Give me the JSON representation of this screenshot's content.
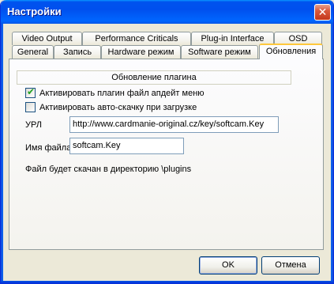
{
  "window": {
    "title": "Настройки"
  },
  "titlebar": {
    "close_glyph": "✕"
  },
  "tabs_row1": [
    "Video Output",
    "Performance Criticals",
    "Plug-in Interface",
    "OSD"
  ],
  "tabs_row2": [
    "General",
    "Запись",
    "Hardware режим",
    "Software режим",
    "Обновления"
  ],
  "panel": {
    "group_title": "Обновление плагина",
    "check_update_label": "Активировать плагин файл апдейт меню",
    "check_update_checked": true,
    "check_autodl_label": "Активировать авто-скачку при загрузке",
    "check_autodl_checked": false,
    "url_label": "УРЛ",
    "url_value": "http://www.cardmanie-original.cz/key/softcam.Key",
    "filename_label": "Имя файла",
    "filename_value": "softcam.Key",
    "note": "Файл будет скачан в директорию \\plugins"
  },
  "buttons": {
    "ok": "OK",
    "cancel": "Отмена"
  },
  "colors": {
    "titlebar": "#0055e5",
    "active_tab_accent": "#ffc83c",
    "window_bg": "#ece9d8"
  }
}
